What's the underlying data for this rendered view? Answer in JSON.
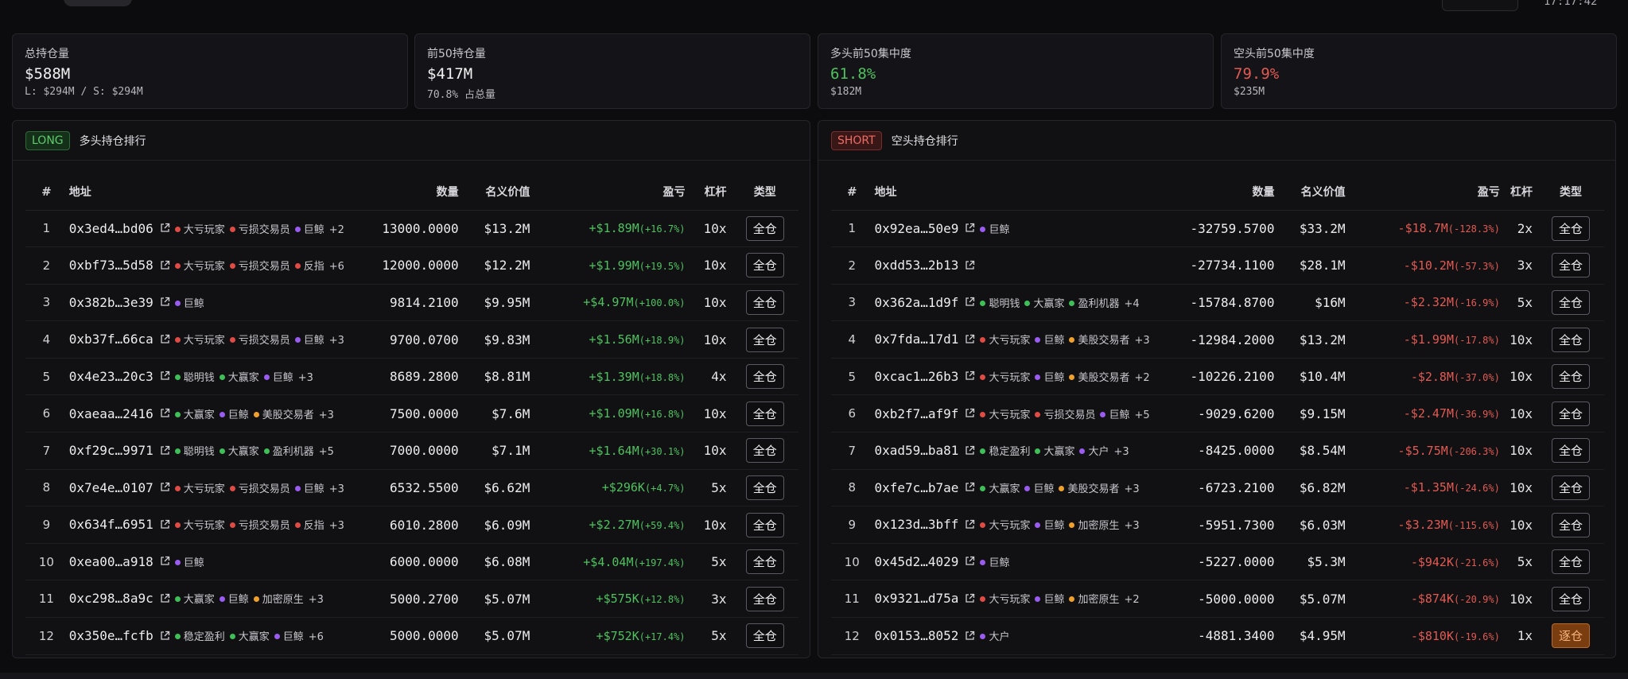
{
  "header": {
    "time": "17:17:42"
  },
  "cards": [
    {
      "label": "总持仓量",
      "value": "$588M",
      "sub": "L: $294M / S: $294M",
      "color": "default"
    },
    {
      "label": "前50持仓量",
      "value": "$417M",
      "sub": "70.8% 占总量",
      "color": "default"
    },
    {
      "label": "多头前50集中度",
      "value": "61.8%",
      "sub": "$182M",
      "color": "green"
    },
    {
      "label": "空头前50集中度",
      "value": "79.9%",
      "sub": "$235M",
      "color": "red"
    }
  ],
  "tag_colors": {
    "red": "#e04b45",
    "purple": "#9a5cf0",
    "green": "#3fbf57",
    "orange": "#f0a02c"
  },
  "columns": {
    "rank": "#",
    "address": "地址",
    "quantity": "数量",
    "notional": "名义价值",
    "pnl": "盈亏",
    "leverage": "杠杆",
    "type": "类型"
  },
  "long_panel": {
    "badge": "LONG",
    "title": "多头持仓排行",
    "rows": [
      {
        "rank": "1",
        "address": "0x3ed4…bd06",
        "tags": [
          {
            "label": "大亏玩家",
            "color": "red"
          },
          {
            "label": "亏损交易员",
            "color": "red"
          },
          {
            "label": "巨鲸",
            "color": "purple"
          }
        ],
        "more": "+2",
        "quantity": "13000.0000",
        "notional": "$13.2M",
        "pnl": "+$1.89M",
        "pnl_pct": "(+16.7%)",
        "leverage": "10x",
        "type": "全仓"
      },
      {
        "rank": "2",
        "address": "0xbf73…5d58",
        "tags": [
          {
            "label": "大亏玩家",
            "color": "red"
          },
          {
            "label": "亏损交易员",
            "color": "red"
          },
          {
            "label": "反指",
            "color": "red"
          }
        ],
        "more": "+6",
        "quantity": "12000.0000",
        "notional": "$12.2M",
        "pnl": "+$1.99M",
        "pnl_pct": "(+19.5%)",
        "leverage": "10x",
        "type": "全仓"
      },
      {
        "rank": "3",
        "address": "0x382b…3e39",
        "tags": [
          {
            "label": "巨鲸",
            "color": "purple"
          }
        ],
        "more": "",
        "quantity": "9814.2100",
        "notional": "$9.95M",
        "pnl": "+$4.97M",
        "pnl_pct": "(+100.0%)",
        "leverage": "10x",
        "type": "全仓"
      },
      {
        "rank": "4",
        "address": "0xb37f…66ca",
        "tags": [
          {
            "label": "大亏玩家",
            "color": "red"
          },
          {
            "label": "亏损交易员",
            "color": "red"
          },
          {
            "label": "巨鲸",
            "color": "purple"
          }
        ],
        "more": "+3",
        "quantity": "9700.0700",
        "notional": "$9.83M",
        "pnl": "+$1.56M",
        "pnl_pct": "(+18.9%)",
        "leverage": "10x",
        "type": "全仓"
      },
      {
        "rank": "5",
        "address": "0x4e23…20c3",
        "tags": [
          {
            "label": "聪明钱",
            "color": "green"
          },
          {
            "label": "大赢家",
            "color": "green"
          },
          {
            "label": "巨鲸",
            "color": "purple"
          }
        ],
        "more": "+3",
        "quantity": "8689.2800",
        "notional": "$8.81M",
        "pnl": "+$1.39M",
        "pnl_pct": "(+18.8%)",
        "leverage": "4x",
        "type": "全仓"
      },
      {
        "rank": "6",
        "address": "0xaeaa…2416",
        "tags": [
          {
            "label": "大赢家",
            "color": "green"
          },
          {
            "label": "巨鲸",
            "color": "purple"
          },
          {
            "label": "美股交易者",
            "color": "orange"
          }
        ],
        "more": "+3",
        "quantity": "7500.0000",
        "notional": "$7.6M",
        "pnl": "+$1.09M",
        "pnl_pct": "(+16.8%)",
        "leverage": "10x",
        "type": "全仓"
      },
      {
        "rank": "7",
        "address": "0xf29c…9971",
        "tags": [
          {
            "label": "聪明钱",
            "color": "green"
          },
          {
            "label": "大赢家",
            "color": "green"
          },
          {
            "label": "盈利机器",
            "color": "green"
          }
        ],
        "more": "+5",
        "quantity": "7000.0000",
        "notional": "$7.1M",
        "pnl": "+$1.64M",
        "pnl_pct": "(+30.1%)",
        "leverage": "10x",
        "type": "全仓"
      },
      {
        "rank": "8",
        "address": "0x7e4e…0107",
        "tags": [
          {
            "label": "大亏玩家",
            "color": "red"
          },
          {
            "label": "亏损交易员",
            "color": "red"
          },
          {
            "label": "巨鲸",
            "color": "purple"
          }
        ],
        "more": "+3",
        "quantity": "6532.5500",
        "notional": "$6.62M",
        "pnl": "+$296K",
        "pnl_pct": "(+4.7%)",
        "leverage": "5x",
        "type": "全仓"
      },
      {
        "rank": "9",
        "address": "0x634f…6951",
        "tags": [
          {
            "label": "大亏玩家",
            "color": "red"
          },
          {
            "label": "亏损交易员",
            "color": "red"
          },
          {
            "label": "反指",
            "color": "red"
          }
        ],
        "more": "+3",
        "quantity": "6010.2800",
        "notional": "$6.09M",
        "pnl": "+$2.27M",
        "pnl_pct": "(+59.4%)",
        "leverage": "10x",
        "type": "全仓"
      },
      {
        "rank": "10",
        "address": "0xea00…a918",
        "tags": [
          {
            "label": "巨鲸",
            "color": "purple"
          }
        ],
        "more": "",
        "quantity": "6000.0000",
        "notional": "$6.08M",
        "pnl": "+$4.04M",
        "pnl_pct": "(+197.4%)",
        "leverage": "5x",
        "type": "全仓"
      },
      {
        "rank": "11",
        "address": "0xc298…8a9c",
        "tags": [
          {
            "label": "大赢家",
            "color": "green"
          },
          {
            "label": "巨鲸",
            "color": "purple"
          },
          {
            "label": "加密原生",
            "color": "orange"
          }
        ],
        "more": "+3",
        "quantity": "5000.2700",
        "notional": "$5.07M",
        "pnl": "+$575K",
        "pnl_pct": "(+12.8%)",
        "leverage": "3x",
        "type": "全仓"
      },
      {
        "rank": "12",
        "address": "0x350e…fcfb",
        "tags": [
          {
            "label": "稳定盈利",
            "color": "green"
          },
          {
            "label": "大赢家",
            "color": "green"
          },
          {
            "label": "巨鲸",
            "color": "purple"
          }
        ],
        "more": "+6",
        "quantity": "5000.0000",
        "notional": "$5.07M",
        "pnl": "+$752K",
        "pnl_pct": "(+17.4%)",
        "leverage": "5x",
        "type": "全仓"
      }
    ]
  },
  "short_panel": {
    "badge": "SHORT",
    "title": "空头持仓排行",
    "rows": [
      {
        "rank": "1",
        "address": "0x92ea…50e9",
        "tags": [
          {
            "label": "巨鲸",
            "color": "purple"
          }
        ],
        "more": "",
        "quantity": "-32759.5700",
        "notional": "$33.2M",
        "pnl": "-$18.7M",
        "pnl_pct": "(-128.3%)",
        "leverage": "2x",
        "type": "全仓"
      },
      {
        "rank": "2",
        "address": "0xdd53…2b13",
        "tags": [],
        "more": "",
        "quantity": "-27734.1100",
        "notional": "$28.1M",
        "pnl": "-$10.2M",
        "pnl_pct": "(-57.3%)",
        "leverage": "3x",
        "type": "全仓"
      },
      {
        "rank": "3",
        "address": "0x362a…1d9f",
        "tags": [
          {
            "label": "聪明钱",
            "color": "green"
          },
          {
            "label": "大赢家",
            "color": "green"
          },
          {
            "label": "盈利机器",
            "color": "green"
          }
        ],
        "more": "+4",
        "quantity": "-15784.8700",
        "notional": "$16M",
        "pnl": "-$2.32M",
        "pnl_pct": "(-16.9%)",
        "leverage": "5x",
        "type": "全仓"
      },
      {
        "rank": "4",
        "address": "0x7fda…17d1",
        "tags": [
          {
            "label": "大亏玩家",
            "color": "red"
          },
          {
            "label": "巨鲸",
            "color": "purple"
          },
          {
            "label": "美股交易者",
            "color": "orange"
          }
        ],
        "more": "+3",
        "quantity": "-12984.2000",
        "notional": "$13.2M",
        "pnl": "-$1.99M",
        "pnl_pct": "(-17.8%)",
        "leverage": "10x",
        "type": "全仓"
      },
      {
        "rank": "5",
        "address": "0xcac1…26b3",
        "tags": [
          {
            "label": "大亏玩家",
            "color": "red"
          },
          {
            "label": "巨鲸",
            "color": "purple"
          },
          {
            "label": "美股交易者",
            "color": "orange"
          }
        ],
        "more": "+2",
        "quantity": "-10226.2100",
        "notional": "$10.4M",
        "pnl": "-$2.8M",
        "pnl_pct": "(-37.0%)",
        "leverage": "10x",
        "type": "全仓"
      },
      {
        "rank": "6",
        "address": "0xb2f7…af9f",
        "tags": [
          {
            "label": "大亏玩家",
            "color": "red"
          },
          {
            "label": "亏损交易员",
            "color": "red"
          },
          {
            "label": "巨鲸",
            "color": "purple"
          }
        ],
        "more": "+5",
        "quantity": "-9029.6200",
        "notional": "$9.15M",
        "pnl": "-$2.47M",
        "pnl_pct": "(-36.9%)",
        "leverage": "10x",
        "type": "全仓"
      },
      {
        "rank": "7",
        "address": "0xad59…ba81",
        "tags": [
          {
            "label": "稳定盈利",
            "color": "green"
          },
          {
            "label": "大赢家",
            "color": "green"
          },
          {
            "label": "大户",
            "color": "purple"
          }
        ],
        "more": "+3",
        "quantity": "-8425.0000",
        "notional": "$8.54M",
        "pnl": "-$5.75M",
        "pnl_pct": "(-206.3%)",
        "leverage": "10x",
        "type": "全仓"
      },
      {
        "rank": "8",
        "address": "0xfe7c…b7ae",
        "tags": [
          {
            "label": "大赢家",
            "color": "green"
          },
          {
            "label": "巨鲸",
            "color": "purple"
          },
          {
            "label": "美股交易者",
            "color": "orange"
          }
        ],
        "more": "+3",
        "quantity": "-6723.2100",
        "notional": "$6.82M",
        "pnl": "-$1.35M",
        "pnl_pct": "(-24.6%)",
        "leverage": "10x",
        "type": "全仓"
      },
      {
        "rank": "9",
        "address": "0x123d…3bff",
        "tags": [
          {
            "label": "大亏玩家",
            "color": "red"
          },
          {
            "label": "巨鲸",
            "color": "purple"
          },
          {
            "label": "加密原生",
            "color": "orange"
          }
        ],
        "more": "+3",
        "quantity": "-5951.7300",
        "notional": "$6.03M",
        "pnl": "-$3.23M",
        "pnl_pct": "(-115.6%)",
        "leverage": "10x",
        "type": "全仓"
      },
      {
        "rank": "10",
        "address": "0x45d2…4029",
        "tags": [
          {
            "label": "巨鲸",
            "color": "purple"
          }
        ],
        "more": "",
        "quantity": "-5227.0000",
        "notional": "$5.3M",
        "pnl": "-$942K",
        "pnl_pct": "(-21.6%)",
        "leverage": "5x",
        "type": "全仓"
      },
      {
        "rank": "11",
        "address": "0x9321…d75a",
        "tags": [
          {
            "label": "大亏玩家",
            "color": "red"
          },
          {
            "label": "巨鲸",
            "color": "purple"
          },
          {
            "label": "加密原生",
            "color": "orange"
          }
        ],
        "more": "+2",
        "quantity": "-5000.0000",
        "notional": "$5.07M",
        "pnl": "-$874K",
        "pnl_pct": "(-20.9%)",
        "leverage": "10x",
        "type": "全仓"
      },
      {
        "rank": "12",
        "address": "0x0153…8052",
        "tags": [
          {
            "label": "大户",
            "color": "purple"
          }
        ],
        "more": "",
        "quantity": "-4881.3400",
        "notional": "$4.95M",
        "pnl": "-$810K",
        "pnl_pct": "(-19.6%)",
        "leverage": "1x",
        "type": "逐仓"
      }
    ]
  }
}
